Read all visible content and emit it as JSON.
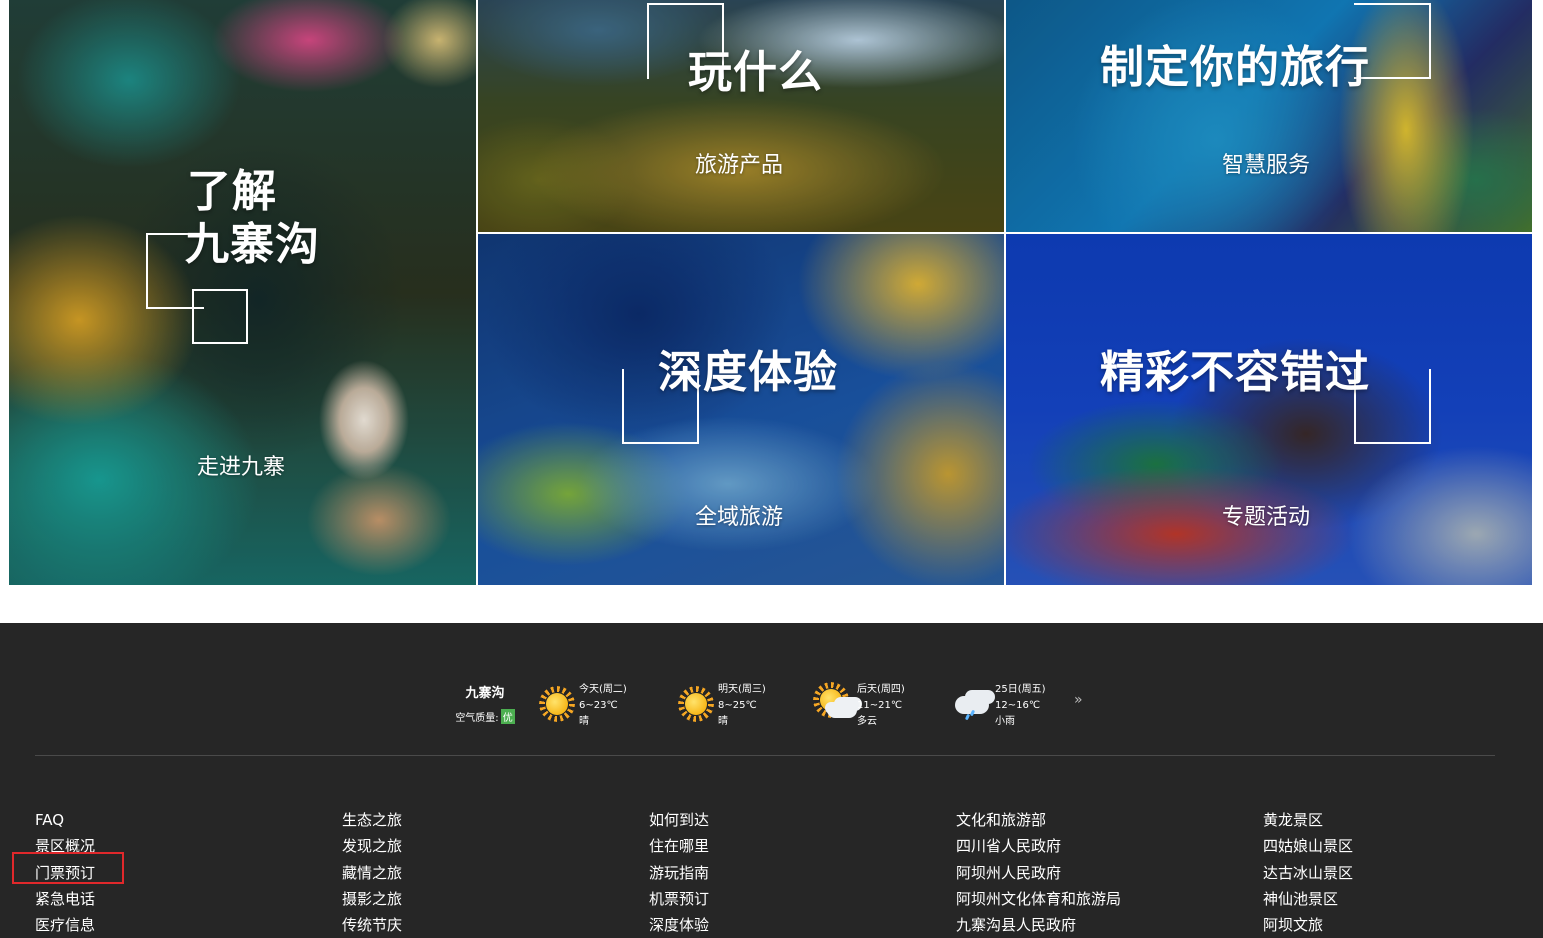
{
  "tiles": {
    "big": {
      "title_line1": "了解",
      "title_line2": "九寨沟",
      "subtitle": "走进九寨"
    },
    "play": {
      "title": "玩什么",
      "subtitle": "旅游产品"
    },
    "plan": {
      "title": "制定你的旅行",
      "subtitle": "智慧服务"
    },
    "deep": {
      "title": "深度体验",
      "subtitle": "全域旅游"
    },
    "fun": {
      "title": "精彩不容错过",
      "subtitle": "专题活动"
    }
  },
  "weather": {
    "city": "九寨沟",
    "air_label": "空气质量:",
    "air_value": "优",
    "more_icon": "double-chevron-right-icon",
    "more_label": "»",
    "days": [
      {
        "day": "今天(周二)",
        "temp": "6~23℃",
        "desc": "晴",
        "icon": "sun-icon"
      },
      {
        "day": "明天(周三)",
        "temp": "8~25℃",
        "desc": "晴",
        "icon": "sun-icon"
      },
      {
        "day": "后天(周四)",
        "temp": "11~21℃",
        "desc": "多云",
        "icon": "partly-cloudy-icon"
      },
      {
        "day": "25日(周五)",
        "temp": "12~16℃",
        "desc": "小雨",
        "icon": "light-rain-icon"
      }
    ]
  },
  "footer_links": {
    "col1": [
      "FAQ",
      "景区概况",
      "门票预订",
      "紧急电话",
      "医疗信息"
    ],
    "col2": [
      "生态之旅",
      "发现之旅",
      "藏情之旅",
      "摄影之旅",
      "传统节庆"
    ],
    "col3": [
      "如何到达",
      "住在哪里",
      "游玩指南",
      "机票预订",
      "深度体验"
    ],
    "col4": [
      "文化和旅游部",
      "四川省人民政府",
      "阿坝州人民政府",
      "阿坝州文化体育和旅游局",
      "九寨沟县人民政府"
    ],
    "col5": [
      "黄龙景区",
      "四姑娘山景区",
      "达古冰山景区",
      "神仙池景区",
      "阿坝文旅"
    ]
  },
  "colors": {
    "footer_bg": "#262626",
    "highlight": "#e0282b",
    "air_badge": "#4caf50"
  }
}
